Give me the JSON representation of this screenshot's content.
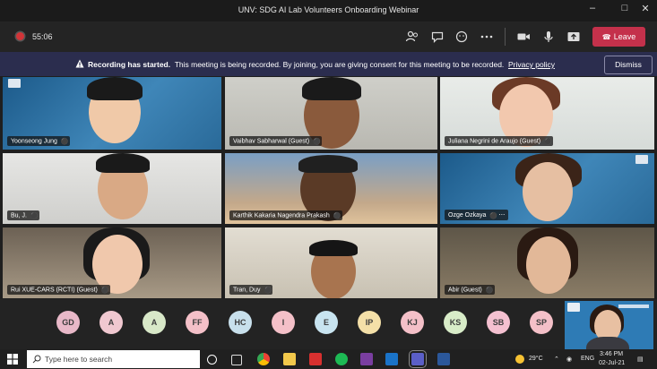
{
  "window": {
    "title": "UNV: SDG AI Lab Volunteers Onboarding Webinar"
  },
  "toolbar": {
    "timer": "55:06",
    "leave_label": "Leave"
  },
  "banner": {
    "title": "Recording has started.",
    "message": "This meeting is being recorded. By joining, you are giving consent for this meeting to be recorded.",
    "link": "Privacy policy",
    "dismiss_label": "Dismiss"
  },
  "participants": [
    {
      "name": "Yoonseong Jung"
    },
    {
      "name": "Vaibhav Sabharwal (Guest)"
    },
    {
      "name": "Juliana Negrini de Araujo (Guest)"
    },
    {
      "name": "Bu, J."
    },
    {
      "name": "Karthik Kakaria Nagendra Prakash"
    },
    {
      "name": "Ozge Ozkaya"
    },
    {
      "name": "Rui XUE-CARS (RCTI) (Guest)"
    },
    {
      "name": "Tran, Duy"
    },
    {
      "name": "Abir (Guest)"
    }
  ],
  "avatars": [
    {
      "initials": "GD",
      "color": "#e8b8c8"
    },
    {
      "initials": "A",
      "color": "#f0c8d0"
    },
    {
      "initials": "A",
      "color": "#d8e8c8"
    },
    {
      "initials": "FF",
      "color": "#f4c0c8"
    },
    {
      "initials": "HC",
      "color": "#c8e0ec"
    },
    {
      "initials": "I",
      "color": "#f4c0c8"
    },
    {
      "initials": "E",
      "color": "#c8e4f0"
    },
    {
      "initials": "IP",
      "color": "#f4e0a8"
    },
    {
      "initials": "KJ",
      "color": "#f4c0c8"
    },
    {
      "initials": "KS",
      "color": "#d8ecc8"
    },
    {
      "initials": "SB",
      "color": "#f4c0d0"
    },
    {
      "initials": "SP",
      "color": "#f4c0c8"
    }
  ],
  "taskbar": {
    "search_placeholder": "Type here to search",
    "temperature": "29°C",
    "language": "ENG",
    "time": "3:46 PM",
    "date": "02-Jul-21"
  }
}
